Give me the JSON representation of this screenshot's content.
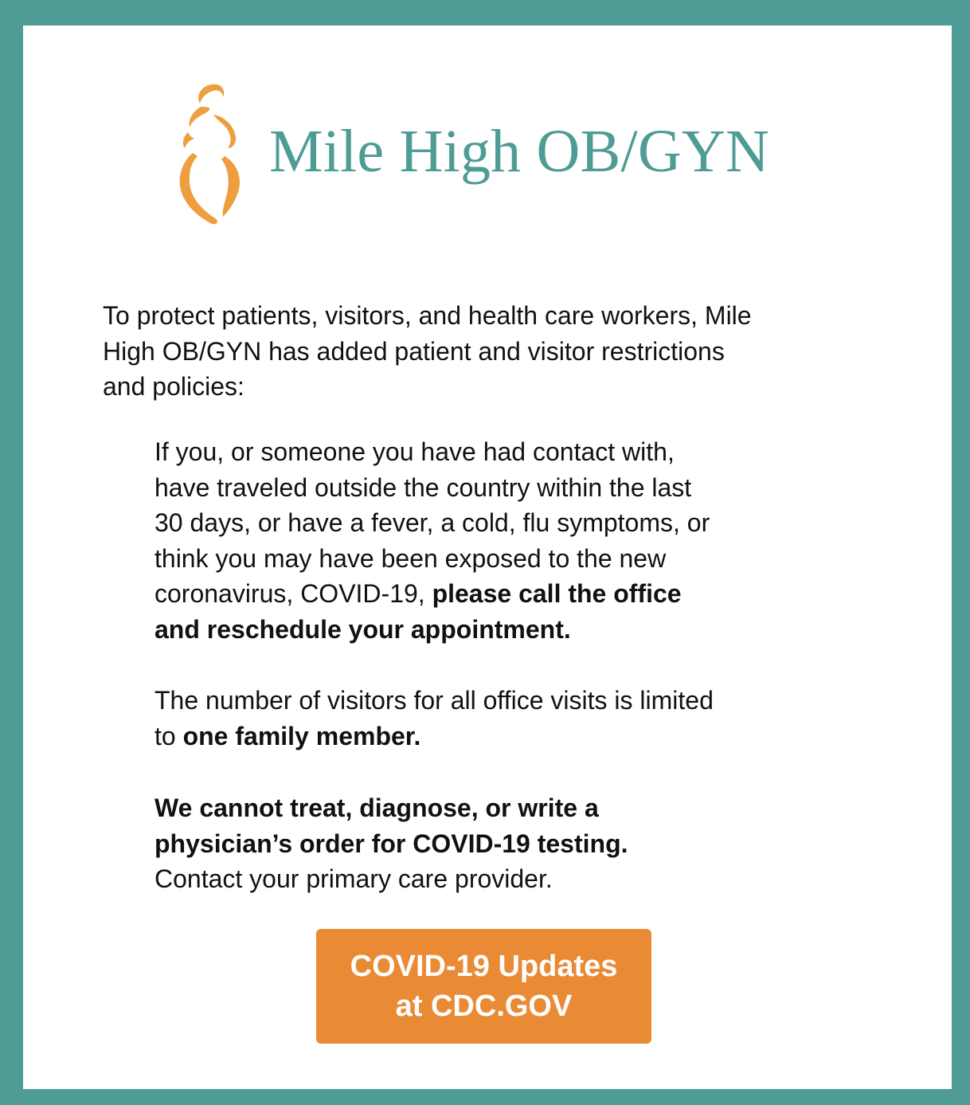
{
  "brand": {
    "name": "Mile High OB/GYN",
    "logo_icon": "pregnant-silhouette-icon",
    "primary_color": "#4e9c95",
    "accent_color": "#e98a35"
  },
  "intro": {
    "line1": "To protect patients, visitors, and health care workers, Mile",
    "line2": "High OB/GYN has added patient and visitor restrictions",
    "line3": "and policies:"
  },
  "policy_exposure": {
    "line1": "If you, or someone you have had contact with,",
    "line2": "have traveled outside the country within the last",
    "line3": "30 days, or have a fever, a cold, flu symptoms, or",
    "line4": "think you may have been exposed to the new",
    "line5_plain": "coronavirus, COVID-19, ",
    "line5_bold": "please call the office",
    "line6_bold": "and reschedule your appointment."
  },
  "policy_visitors": {
    "line1": "The number of visitors for all office visits is limited",
    "line2_plain": "to ",
    "line2_bold": "one family member."
  },
  "policy_testing": {
    "line1_bold": "We cannot treat, diagnose, or write a",
    "line2_bold": "physician’s order for COVID-19 testing.",
    "line3": "Contact your primary care provider."
  },
  "cdc_button": {
    "line1": "COVID-19 Updates",
    "line2": "at CDC.GOV"
  }
}
